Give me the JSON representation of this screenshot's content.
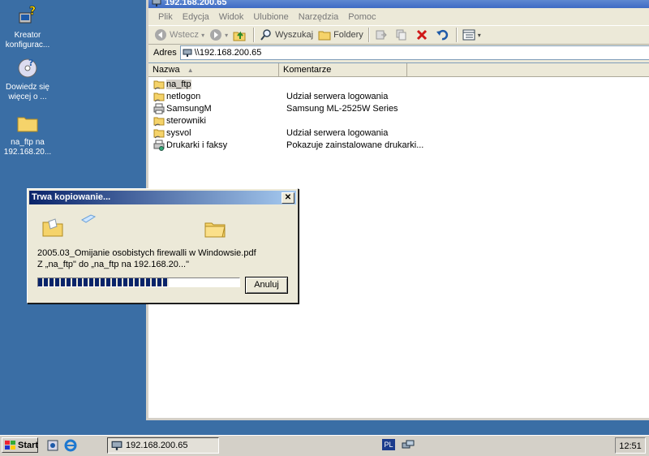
{
  "desktop": {
    "icons": [
      {
        "label": "Kreator\nkonfigurac...",
        "icon": "wizard-icon"
      },
      {
        "label": "Dowiedz się\nwięcej o ...",
        "icon": "help-cd-icon"
      },
      {
        "label": "na_ftp na\n192.168.20...",
        "icon": "folder-icon"
      }
    ]
  },
  "explorer": {
    "title": "192.168.200.65",
    "menu": [
      "Plik",
      "Edycja",
      "Widok",
      "Ulubione",
      "Narzędzia",
      "Pomoc"
    ],
    "toolbar": {
      "back": "Wstecz",
      "search": "Wyszukaj",
      "folders": "Foldery"
    },
    "address_label": "Adres",
    "address_value": "\\\\192.168.200.65",
    "columns": [
      "Nazwa",
      "Komentarze"
    ],
    "items": [
      {
        "name": "na_ftp",
        "comment": "",
        "icon": "share-folder-icon",
        "selected": true
      },
      {
        "name": "netlogon",
        "comment": "Udział serwera logowania",
        "icon": "share-folder-icon"
      },
      {
        "name": "SamsungM",
        "comment": "Samsung ML-2525W Series",
        "icon": "printer-icon"
      },
      {
        "name": "sterowniki",
        "comment": "",
        "icon": "share-folder-icon"
      },
      {
        "name": "sysvol",
        "comment": "Udział serwera logowania",
        "icon": "share-folder-icon"
      },
      {
        "name": "Drukarki i faksy",
        "comment": "Pokazuje zainstalowane drukarki...",
        "icon": "printers-faxes-icon"
      }
    ]
  },
  "copy_dialog": {
    "title": "Trwa kopiowanie...",
    "file_name": "2005.03_Omijanie osobistych firewalli w Windowsie.pdf",
    "from_to": "Z „na_ftp\" do „na_ftp na 192.168.20...\"",
    "progress": 0.65,
    "cancel_label": "Anuluj"
  },
  "taskbar": {
    "start_label": "Start",
    "window_button": "192.168.200.65",
    "language": "PL",
    "clock": "12:51"
  },
  "colors": {
    "desktop": "#3a6ea5",
    "dialog_title_start": "#0a246a",
    "dialog_title_end": "#a6caf0"
  }
}
